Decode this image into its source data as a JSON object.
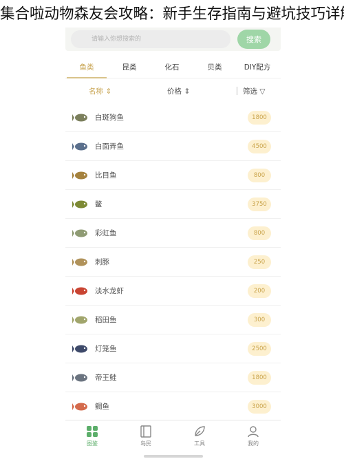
{
  "article_title": "集合啦动物森友会攻略：新手生存指南与避坑技巧详解总汇",
  "search": {
    "placeholder": "请输入你想搜索的",
    "button_label": "搜索"
  },
  "category_tabs": [
    {
      "label": "鱼类",
      "active": true
    },
    {
      "label": "昆类",
      "active": false
    },
    {
      "label": "化石",
      "active": false
    },
    {
      "label": "贝类",
      "active": false
    },
    {
      "label": "DIY配方",
      "active": false
    }
  ],
  "sort_bar": {
    "name_label": "名称 ⇕",
    "price_label": "价格 ⇕",
    "filter_label": "筛选 ▽"
  },
  "fish_list": [
    {
      "name": "白斑狗鱼",
      "price": "1800",
      "icon": "pike-fish-icon",
      "color": "#7b7f5c"
    },
    {
      "name": "白面弄鱼",
      "price": "4500",
      "icon": "blue-fish-icon",
      "color": "#5a6f8c"
    },
    {
      "name": "比目鱼",
      "price": "800",
      "icon": "flatfish-icon",
      "color": "#a5823e"
    },
    {
      "name": "鳖",
      "price": "3750",
      "icon": "turtle-icon",
      "color": "#7d8a35"
    },
    {
      "name": "彩虹鱼",
      "price": "800",
      "icon": "rainbow-fish-icon",
      "color": "#8f9b74"
    },
    {
      "name": "刺豚",
      "price": "250",
      "icon": "pufferfish-icon",
      "color": "#b0925a"
    },
    {
      "name": "淡水龙虾",
      "price": "200",
      "icon": "crayfish-icon",
      "color": "#c94432"
    },
    {
      "name": "稻田鱼",
      "price": "300",
      "icon": "ricefish-icon",
      "color": "#a1a56c"
    },
    {
      "name": "灯笼鱼",
      "price": "2500",
      "icon": "lanternfish-icon",
      "color": "#3e4a6a"
    },
    {
      "name": "帝王鲑",
      "price": "1800",
      "icon": "king-salmon-icon",
      "color": "#6b7480"
    },
    {
      "name": "鲷鱼",
      "price": "3000",
      "icon": "sea-bream-icon",
      "color": "#d46a4c"
    }
  ],
  "bottom_nav": [
    {
      "label": "图鉴",
      "icon": "grid-icon",
      "active": true
    },
    {
      "label": "岛民",
      "icon": "book-icon",
      "active": false
    },
    {
      "label": "工具",
      "icon": "leaf-icon",
      "active": false
    },
    {
      "label": "我的",
      "icon": "user-icon",
      "active": false
    }
  ],
  "colors": {
    "accent": "#c8a451",
    "price_pill_bg": "#fdf0cf",
    "nav_active": "#5cae6a",
    "search_button": "#9fd6a7"
  }
}
